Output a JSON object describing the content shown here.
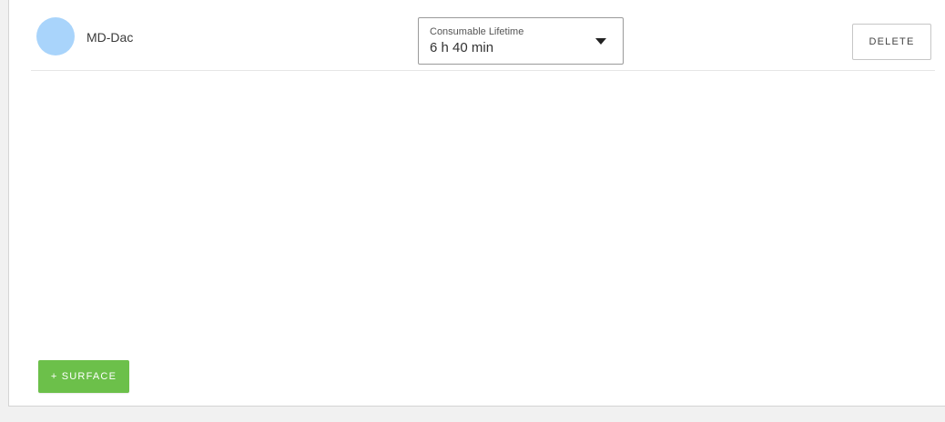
{
  "row": {
    "name": "MD-Dac",
    "avatar_color": "#a9d4fb",
    "consumable_select": {
      "label": "Consumable Lifetime",
      "value": "6 h 40 min"
    },
    "delete_label": "DELETE"
  },
  "actions": {
    "add_surface_label": "+ SURFACE",
    "add_surface_color": "#6cc04a"
  }
}
